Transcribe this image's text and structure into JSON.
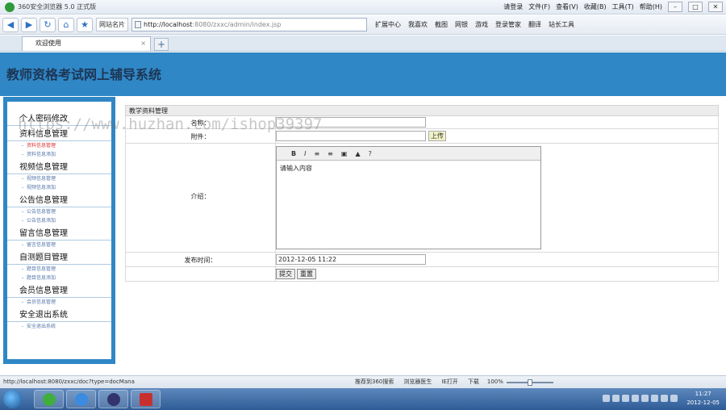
{
  "browser": {
    "title": "360安全浏览器 5.0 正式版",
    "right_menu": [
      "请登录",
      "文件(F)",
      "查看(V)",
      "收藏(B)",
      "工具(T)",
      "帮助(H)"
    ],
    "nav_fav": "网站名片",
    "address_host": "http://localhost",
    "address_rest": ":8080/zxxc/admin/index.jsp",
    "nav_tools": [
      "扩展中心",
      "我喜欢",
      "截图",
      "网银",
      "游戏",
      "登录管家",
      "翻译",
      "站长工具"
    ],
    "tab_title": "欢迎使用",
    "status_url": "http://localhost:8080/zxxc/doc?type=docMana",
    "status_items": [
      "推荐到360搜索",
      "浏览器医生",
      "IE打开",
      "下载"
    ],
    "zoom": "100%",
    "clock_time": "11:27",
    "clock_date": "2012-12-05"
  },
  "app": {
    "system_title": "教师资格考试网上辅导系统"
  },
  "sidebar": {
    "groups": [
      {
        "title": "个人密码修改",
        "items": []
      },
      {
        "title": "资料信息管理",
        "items": [
          {
            "label": "资料信息管理",
            "active": true
          },
          {
            "label": "资料信息添加",
            "active": false
          }
        ]
      },
      {
        "title": "视频信息管理",
        "items": [
          {
            "label": "视频信息管理"
          },
          {
            "label": "视频信息添加"
          }
        ]
      },
      {
        "title": "公告信息管理",
        "items": [
          {
            "label": "公告信息管理"
          },
          {
            "label": "公告信息添加"
          }
        ]
      },
      {
        "title": "留言信息管理",
        "items": [
          {
            "label": "留言信息管理"
          }
        ]
      },
      {
        "title": "自测题目管理",
        "items": [
          {
            "label": "题目信息管理"
          },
          {
            "label": "题目信息添加"
          }
        ]
      },
      {
        "title": "会员信息管理",
        "items": [
          {
            "label": "会员信息管理"
          }
        ]
      },
      {
        "title": "安全退出系统",
        "items": [
          {
            "label": "安全退出系统"
          }
        ]
      }
    ]
  },
  "form": {
    "section_title": "教学资料管理",
    "name_label": "名称：",
    "attachment_label": "附件：",
    "upload_label": "上传",
    "intro_label": "介绍：",
    "editor_toolbar": [
      "B",
      "I",
      "≡",
      "≡",
      "▣",
      "▲",
      "?"
    ],
    "editor_content": "请输入内容",
    "publish_time_label": "发布时间：",
    "publish_time_value": "2012-12-05 11:22",
    "submit_label": "提交",
    "reset_label": "重置"
  },
  "watermark": "https://www.huzhan.com/ishop39397",
  "colors": {
    "header_blue": "#2f87c6",
    "active_red": "#dd3333"
  }
}
